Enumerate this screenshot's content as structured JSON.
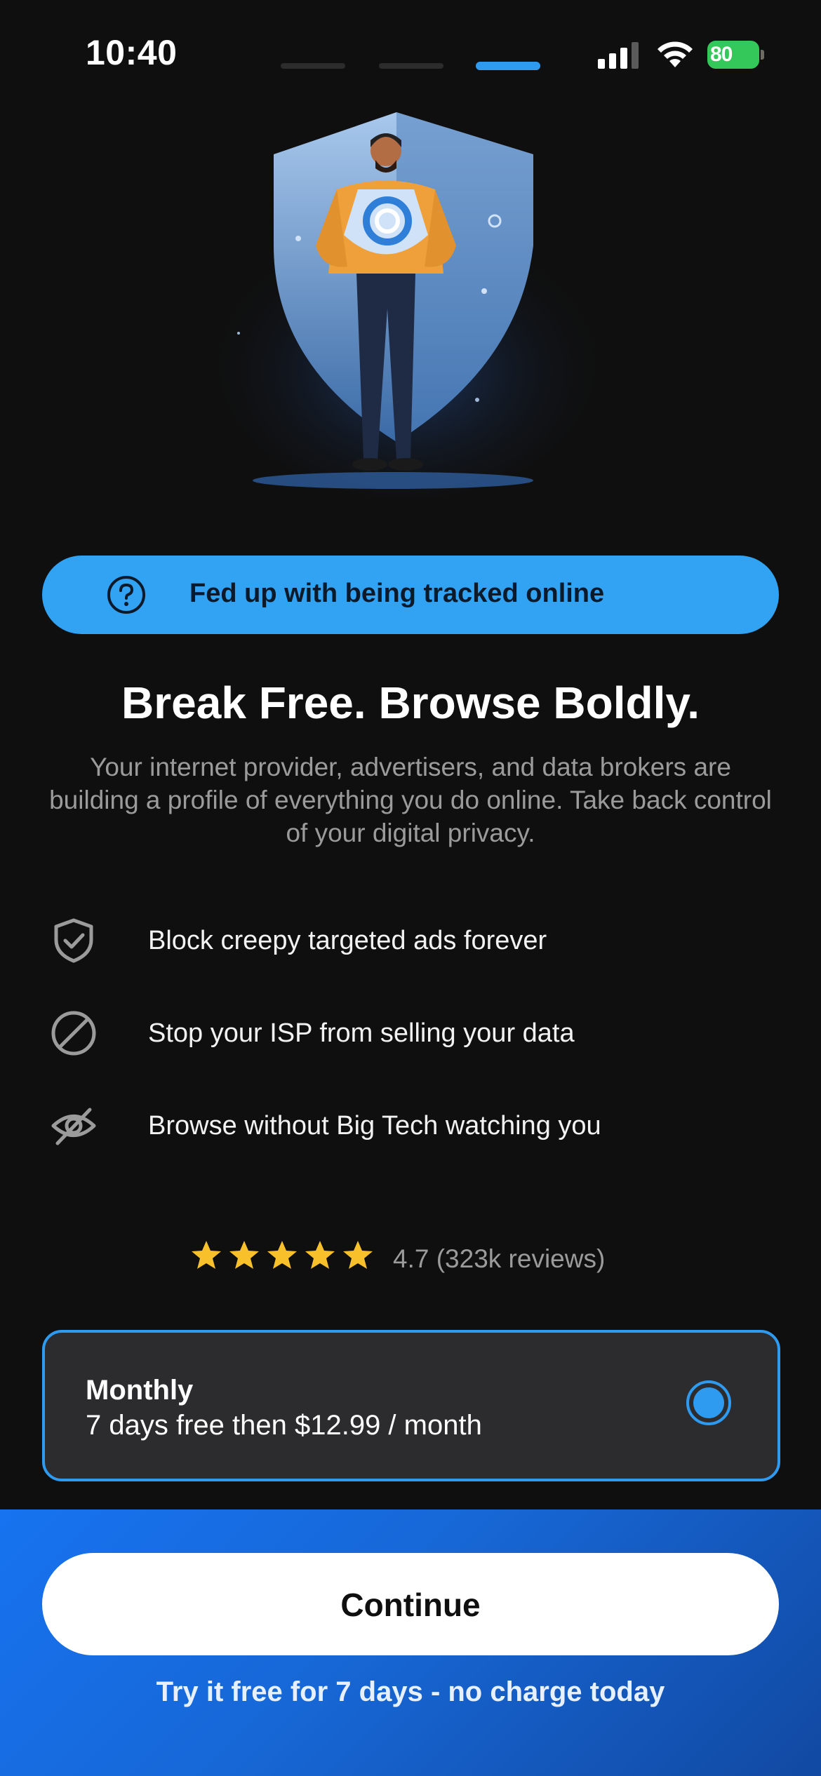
{
  "status_bar": {
    "time": "10:40",
    "battery": "80",
    "battery_color": "#34c759",
    "page_indicator_active": 3,
    "page_indicator_count": 3
  },
  "hero": {
    "icon": "shield-person-illustration-icon"
  },
  "banner": {
    "icon": "question-circle-icon",
    "text": "Fed up with being tracked online"
  },
  "headline": "Break Free. Browse Boldly.",
  "subtext": "Your internet provider, advertisers, and data brokers are building a profile of everything you do online. Take back control of your digital privacy.",
  "features": [
    {
      "icon": "shield-check-icon",
      "text": "Block creepy targeted ads forever"
    },
    {
      "icon": "block-icon",
      "text": "Stop your ISP from selling your data"
    },
    {
      "icon": "eye-slash-icon",
      "text": "Browse without Big Tech watching you"
    }
  ],
  "rating": {
    "stars": 5,
    "text": "4.7 (323k reviews)",
    "star_color": "#f8c02a"
  },
  "plan": {
    "title": "Monthly",
    "price_text": "7 days free then $12.99 / month",
    "selected": true,
    "accent": "#2f9bf0"
  },
  "cta": {
    "button_label": "Continue",
    "subtext": "Try it free for 7 days - no charge today"
  },
  "colors": {
    "background": "#0f0f0f",
    "banner": "#32a2f2",
    "panel_gradient_start": "#1773f0",
    "panel_gradient_end": "#1149a2"
  }
}
